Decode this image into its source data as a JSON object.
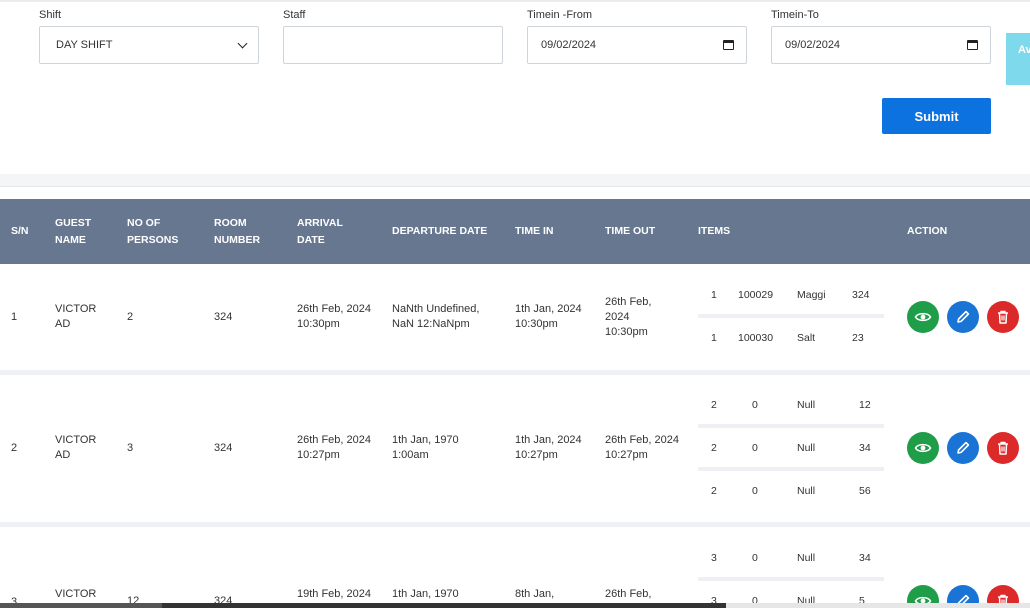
{
  "filters": {
    "shift_label": "Shift",
    "shift_value": "DAY SHIFT",
    "staff_label": "Staff",
    "staff_value": "",
    "timein_from_label": "Timein -From",
    "timein_from_value": "09/02/2024",
    "timein_to_label": "Timein-To",
    "timein_to_value": "09/02/2024",
    "submit_label": "Submit",
    "avail_label": "Av R"
  },
  "table": {
    "headers": [
      "S/N",
      "GUEST NAME",
      "NO OF PERSONS",
      "ROOM NUMBER",
      "ARRIVAL DATE",
      "DEPARTURE DATE",
      "TIME IN",
      "TIME OUT",
      "ITEMS",
      "ACTION"
    ],
    "rows": [
      {
        "sn": "1",
        "guest": "VICTOR AD",
        "persons": "2",
        "room": "324",
        "arrival": "26th Feb, 2024 10:30pm",
        "departure": "NaNth Undefined, NaN 12:NaNpm",
        "time_in": "1th Jan, 2024 10:30pm",
        "time_out": "26th Feb, 2024 10:30pm",
        "items": [
          {
            "qty": "1",
            "code": "100029",
            "name": "Maggi",
            "amount": "324"
          },
          {
            "qty": "1",
            "code": "100030",
            "name": "Salt",
            "amount": "23"
          }
        ]
      },
      {
        "sn": "2",
        "guest": "VICTOR AD",
        "persons": "3",
        "room": "324",
        "arrival": "26th Feb, 2024 10:27pm",
        "departure": "1th Jan, 1970 1:00am",
        "time_in": "1th Jan, 2024 10:27pm",
        "time_out": "26th Feb, 2024 10:27pm",
        "items": [
          {
            "qty": "2",
            "code": "0",
            "name": "Null",
            "amount": "12"
          },
          {
            "qty": "2",
            "code": "0",
            "name": "Null",
            "amount": "34"
          },
          {
            "qty": "2",
            "code": "0",
            "name": "Null",
            "amount": "56"
          }
        ]
      },
      {
        "sn": "3",
        "guest": "VICTOR",
        "persons": "12",
        "room": "324",
        "arrival": "19th Feb, 2024",
        "departure": "1th Jan, 1970",
        "time_in": "8th Jan,",
        "time_out": "26th Feb,",
        "items": [
          {
            "qty": "3",
            "code": "0",
            "name": "Null",
            "amount": "34"
          },
          {
            "qty": "3",
            "code": "0",
            "name": "Null",
            "amount": "5"
          }
        ]
      }
    ]
  },
  "icons": {
    "view": "eye-icon",
    "edit": "pencil-icon",
    "delete": "trash-icon"
  },
  "colors": {
    "header_bg": "#67778f",
    "submit": "#0b72e0",
    "view": "#1f9d48",
    "edit": "#1a74d6",
    "delete": "#dc2a2a"
  }
}
